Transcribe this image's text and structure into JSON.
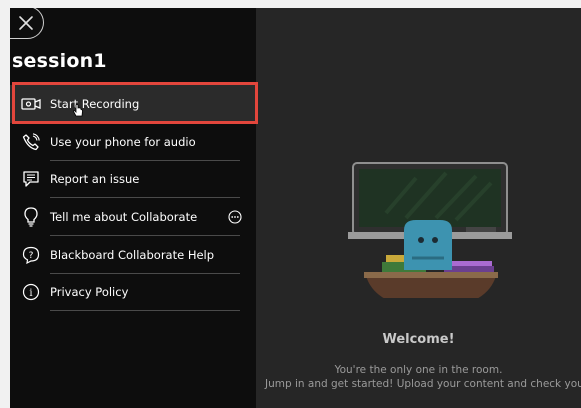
{
  "session": {
    "title": "session1"
  },
  "menu": {
    "items": [
      {
        "label": "Start Recording",
        "icon": "video-camera-icon"
      },
      {
        "label": "Use your phone for audio",
        "icon": "phone-icon"
      },
      {
        "label": "Report an issue",
        "icon": "report-icon"
      },
      {
        "label": "Tell me about Collaborate",
        "icon": "lightbulb-icon"
      },
      {
        "label": "Blackboard Collaborate Help",
        "icon": "help-icon"
      },
      {
        "label": "Privacy Policy",
        "icon": "info-icon"
      }
    ]
  },
  "welcome": {
    "title": "Welcome!",
    "line1": "You're the only one in the room.",
    "line2": "Jump in and get started! Upload your content and check your audi"
  },
  "colors": {
    "highlight": "#e2463c",
    "menu_bg": "#0d0d0d",
    "stage_bg": "#262626"
  }
}
